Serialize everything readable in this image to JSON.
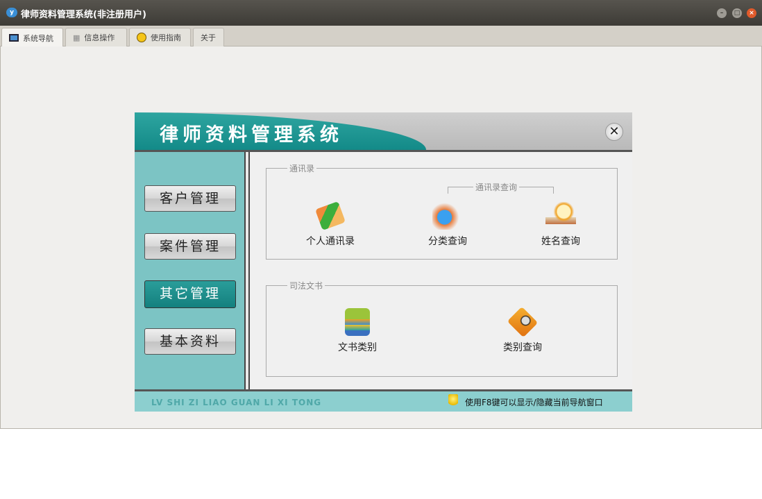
{
  "window": {
    "title": "律师资料管理系统(非注册用户)"
  },
  "tabs": [
    {
      "label": "系统导航",
      "icon": "monitor-icon"
    },
    {
      "label": "信息操作",
      "icon": "grid-icon"
    },
    {
      "label": "使用指南",
      "icon": "help-icon"
    },
    {
      "label": "关于"
    }
  ],
  "panel": {
    "title": "律师资料管理系统",
    "sidebar": [
      "客户管理",
      "案件管理",
      "其它管理",
      "基本资料"
    ],
    "group1": {
      "legend": "通讯录",
      "sub_legend": "通讯录查询",
      "items": [
        "个人通讯录",
        "分类查询",
        "姓名查询"
      ]
    },
    "group2": {
      "legend": "司法文书",
      "items": [
        "文书类别",
        "类别查询"
      ]
    },
    "footer": {
      "pinyin": "LV SHI ZI LIAO GUAN LI XI TONG",
      "tip": "使用F8键可以显示/隐藏当前导航窗口"
    }
  },
  "colors": {
    "teal": "#14807e",
    "sidebar": "#7cc4c4",
    "footer": "#8ccfcf"
  }
}
